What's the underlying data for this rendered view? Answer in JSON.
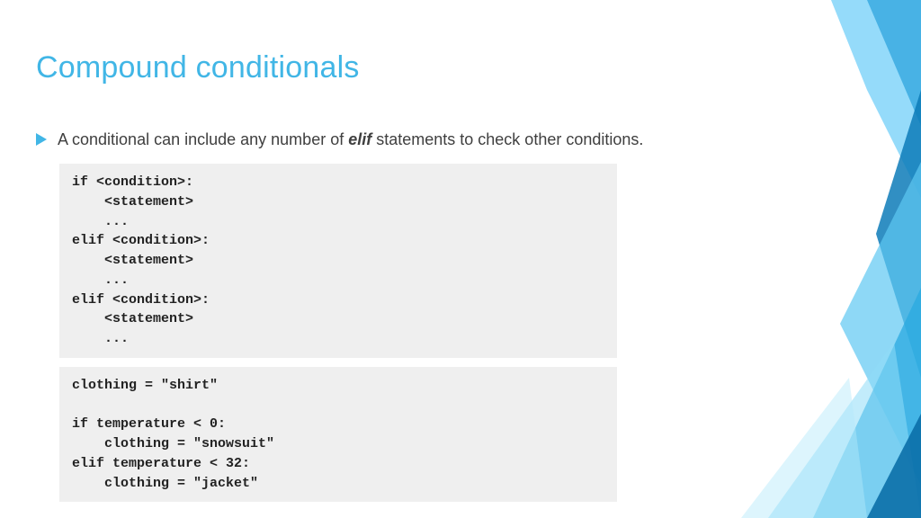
{
  "title": "Compound conditionals",
  "bullet": {
    "pre": "A conditional can include any number of ",
    "bold": "elif",
    "post": " statements to check other conditions."
  },
  "code1": "if <condition>:\n    <statement>\n    ...\nelif <condition>:\n    <statement>\n    ...\nelif <condition>:\n    <statement>\n    ...",
  "code2": "clothing = \"shirt\"\n\nif temperature < 0:\n    clothing = \"snowsuit\"\nelif temperature < 32:\n    clothing = \"jacket\"",
  "accent": "#41b6e6"
}
